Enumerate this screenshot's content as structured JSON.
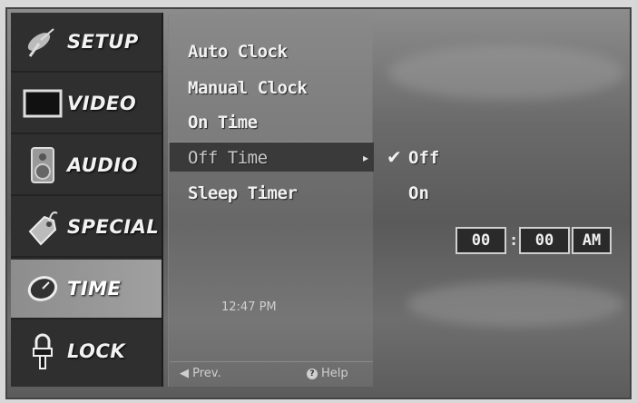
{
  "sidebar": {
    "items": [
      {
        "label": "SETUP",
        "icon": "satellite-icon"
      },
      {
        "label": "VIDEO",
        "icon": "tv-screen-icon"
      },
      {
        "label": "AUDIO",
        "icon": "speaker-icon"
      },
      {
        "label": "SPECIAL",
        "icon": "tag-icon"
      },
      {
        "label": "TIME",
        "icon": "clock-icon",
        "active": true
      },
      {
        "label": "LOCK",
        "icon": "padlock-icon"
      }
    ]
  },
  "menu": {
    "items": [
      "Auto Clock",
      "Manual Clock",
      "On Time",
      "Off Time",
      "Sleep Timer"
    ],
    "selected": "Off Time"
  },
  "options": {
    "off": "Off",
    "on": "On",
    "checked": "Off"
  },
  "time_entry": {
    "hours": "00",
    "minutes": "00",
    "separator": ":",
    "period": "AM"
  },
  "status": {
    "clock": "12:47 PM"
  },
  "footer": {
    "prev": "Prev.",
    "help": "Help"
  },
  "colors": {
    "sidebar_bg": "#2f2f2f",
    "active_bg": "#999999",
    "highlight_row": "#3a3a3a"
  }
}
